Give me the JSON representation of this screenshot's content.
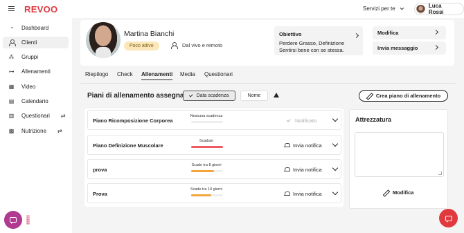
{
  "app": {
    "brand": "REVOO",
    "services_label": "Servizi per te",
    "user_name": "Luca Rossi"
  },
  "sidebar": {
    "items": [
      {
        "label": "Dashboard",
        "icon": "gauge-icon"
      },
      {
        "label": "Clienti",
        "icon": "user-icon",
        "active": true
      },
      {
        "label": "Gruppi",
        "icon": "group-icon"
      },
      {
        "label": "Allenamenti",
        "icon": "dumbbell-icon"
      },
      {
        "label": "Video",
        "icon": "film-icon"
      },
      {
        "label": "Calendario",
        "icon": "calendar-icon"
      },
      {
        "label": "Questionari",
        "icon": "document-icon",
        "extra": "switch-icon"
      },
      {
        "label": "Nutrizione",
        "icon": "grid-icon",
        "extra": "switch-icon"
      }
    ]
  },
  "client": {
    "name": "Martina Bianchi",
    "status": "Poco attivo",
    "mode": "Dal vivo e remoto",
    "goal_title": "Obiettivo",
    "goal_text": "Perdere Grasso, Definizione Sentirsi bene con se stessa.",
    "edit_label": "Modifica",
    "message_label": "Invia messaggio"
  },
  "tabs": [
    "Riepilogo",
    "Check",
    "Allenamenti",
    "Media",
    "Questionari"
  ],
  "active_tab": "Allenamenti",
  "plans": {
    "title": "Piani di allenamento assegnati",
    "sort_date": "Data scadenza",
    "sort_name": "Nome",
    "create_label": "Crea piano di allenamento",
    "rows": [
      {
        "name": "Piano Ricomposizione Corporea",
        "status": "Nessuna scadenza",
        "progress": 0,
        "bar_color": "#e8e8e8",
        "action": "Notificato",
        "notified": true
      },
      {
        "name": "Piano Definizione Muscolare",
        "status": "Scaduto",
        "progress": 1.0,
        "bar_color": "#ef5b60",
        "action": "Invia notifica",
        "notified": false
      },
      {
        "name": "prova",
        "status": "Scade tra 8 giorni",
        "progress": 0.72,
        "bar_color": "#f3a53b",
        "action": "Invia notifica",
        "notified": false
      },
      {
        "name": "Prova",
        "status": "Scade tra 10 giorni",
        "progress": 0.62,
        "bar_color": "#f3a53b",
        "action": "Invia notifica",
        "notified": false
      }
    ]
  },
  "equipment": {
    "title": "Attrezzatura",
    "edit_label": "Modifica"
  },
  "colors": {
    "brand": "#e0393e",
    "badge_bg": "#fbe7b9",
    "fab_left": "#b03a8f",
    "fab_right": "#e0393e"
  }
}
